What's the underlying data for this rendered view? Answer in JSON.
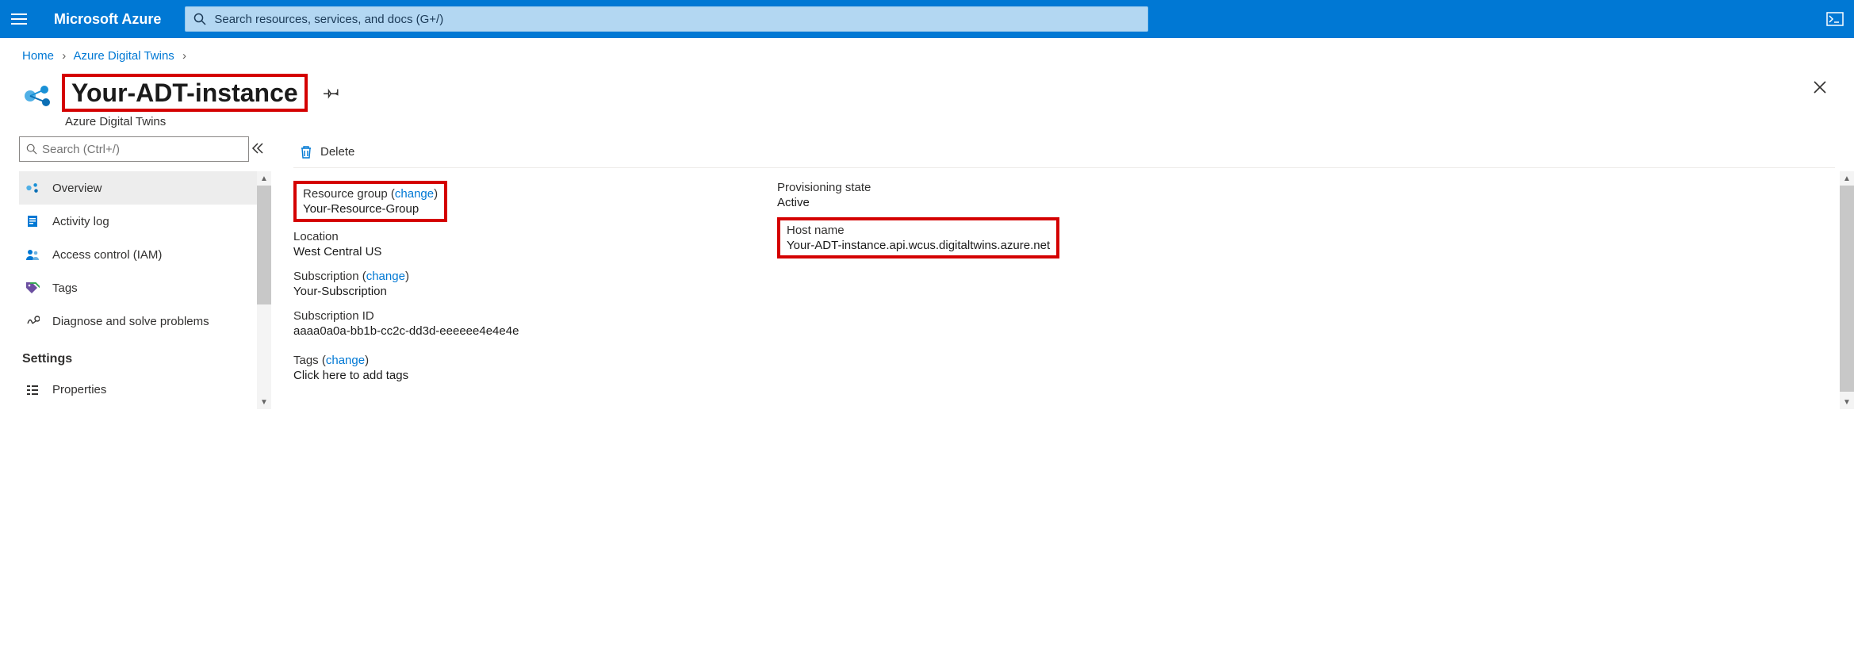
{
  "brand": "Microsoft Azure",
  "search": {
    "placeholder": "Search resources, services, and docs (G+/)"
  },
  "breadcrumb": {
    "home": "Home",
    "parent": "Azure Digital Twins"
  },
  "header": {
    "title": "Your-ADT-instance",
    "subtitle": "Azure Digital Twins"
  },
  "sidebar": {
    "search_placeholder": "Search (Ctrl+/)",
    "items": {
      "overview": "Overview",
      "activity": "Activity log",
      "iam": "Access control (IAM)",
      "tags": "Tags",
      "diagnose": "Diagnose and solve problems"
    },
    "settings_heading": "Settings",
    "properties": "Properties"
  },
  "toolbar": {
    "delete": "Delete"
  },
  "essentials": {
    "rg_label": "Resource group",
    "change": "change",
    "rg_value": "Your-Resource-Group",
    "location_label": "Location",
    "location_value": "West Central US",
    "sub_label": "Subscription",
    "sub_value": "Your-Subscription",
    "subid_label": "Subscription ID",
    "subid_value": "aaaa0a0a-bb1b-cc2c-dd3d-eeeeee4e4e4e",
    "tags_label": "Tags",
    "tags_action": "Click here to add tags",
    "prov_label": "Provisioning state",
    "prov_value": "Active",
    "host_label": "Host name",
    "host_value": "Your-ADT-instance.api.wcus.digitaltwins.azure.net"
  }
}
